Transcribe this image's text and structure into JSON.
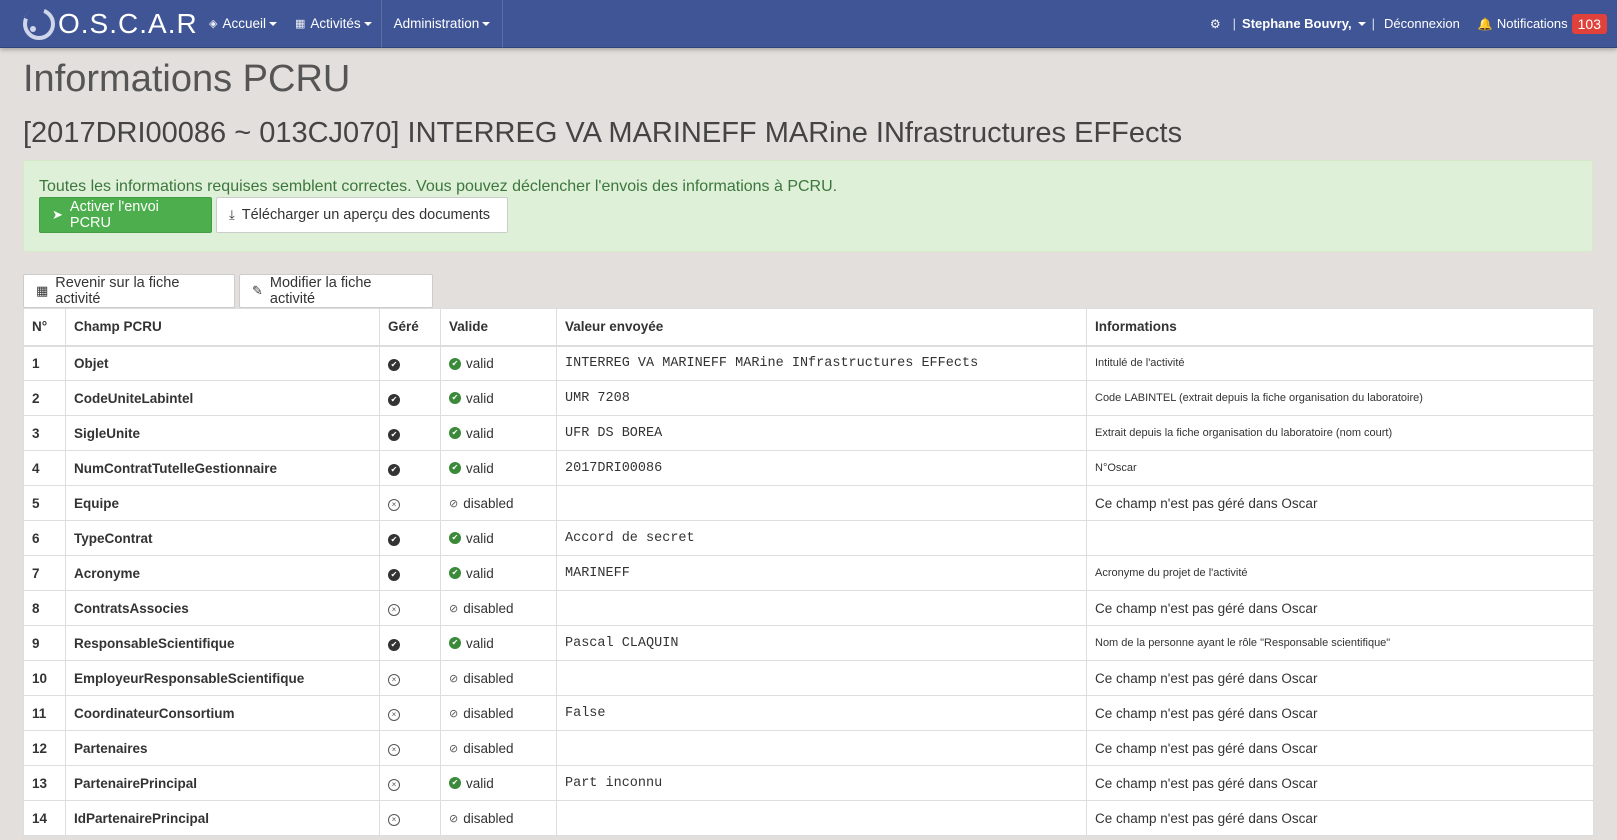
{
  "nav": {
    "brand": "O.S.C.A.R",
    "accueil": "Accueil",
    "activites": "Activités",
    "administration": "Administration",
    "separator": "|",
    "user": "Stephane Bouvry,",
    "logout": "Déconnexion",
    "notifications": "Notifications",
    "notifications_count": "103"
  },
  "page": {
    "title": "Informations PCRU",
    "activity_title": "[2017DRI00086 ~ 013CJ070] INTERREG VA MARINEFF MARine INfrastructures EFFects"
  },
  "alert": {
    "text": "Toutes les informations requises semblent correctes. Vous pouvez déclencher l'envois des informations à PCRU.",
    "activate_button": "Activer l'envoi PCRU",
    "download_button": "Télécharger un aperçu des documents"
  },
  "actions": {
    "back_button": "Revenir sur la fiche activité",
    "edit_button": "Modifier la fiche activité"
  },
  "table": {
    "headers": [
      "N°",
      "Champ PCRU",
      "Géré",
      "Valide",
      "Valeur envoyée",
      "Informations"
    ],
    "rows": [
      {
        "num": "1",
        "field": "Objet",
        "gere": true,
        "status": "valid",
        "value": "INTERREG VA MARINEFF MARine INfrastructures EFFects",
        "info": "Intitulé de l'activité",
        "info_small": true
      },
      {
        "num": "2",
        "field": "CodeUniteLabintel",
        "gere": true,
        "status": "valid",
        "value": "UMR 7208",
        "info": "Code LABINTEL (extrait depuis la fiche organisation du laboratoire)",
        "info_small": true
      },
      {
        "num": "3",
        "field": "SigleUnite",
        "gere": true,
        "status": "valid",
        "value": "UFR DS BOREA",
        "info": "Extrait depuis la fiche organisation du laboratoire (nom court)",
        "info_small": true
      },
      {
        "num": "4",
        "field": "NumContratTutelleGestionnaire",
        "gere": true,
        "status": "valid",
        "value": "2017DRI00086",
        "info": "N°Oscar",
        "info_small": true
      },
      {
        "num": "5",
        "field": "Equipe",
        "gere": false,
        "status": "disabled",
        "value": "",
        "info": "Ce champ n'est pas géré dans Oscar",
        "info_small": false
      },
      {
        "num": "6",
        "field": "TypeContrat",
        "gere": true,
        "status": "valid",
        "value": "Accord de secret",
        "info": "",
        "info_small": false
      },
      {
        "num": "7",
        "field": "Acronyme",
        "gere": true,
        "status": "valid",
        "value": "MARINEFF",
        "info": "Acronyme du projet de l'activité",
        "info_small": true
      },
      {
        "num": "8",
        "field": "ContratsAssocies",
        "gere": false,
        "status": "disabled",
        "value": "",
        "info": "Ce champ n'est pas géré dans Oscar",
        "info_small": false
      },
      {
        "num": "9",
        "field": "ResponsableScientifique",
        "gere": true,
        "status": "valid",
        "value": "Pascal CLAQUIN",
        "info": "Nom de la personne ayant le rôle \"Responsable scientifique\"",
        "info_small": true
      },
      {
        "num": "10",
        "field": "EmployeurResponsableScientifique",
        "gere": false,
        "status": "disabled",
        "value": "",
        "info": "Ce champ n'est pas géré dans Oscar",
        "info_small": false
      },
      {
        "num": "11",
        "field": "CoordinateurConsortium",
        "gere": false,
        "status": "disabled",
        "value": "False",
        "info": "Ce champ n'est pas géré dans Oscar",
        "info_small": false
      },
      {
        "num": "12",
        "field": "Partenaires",
        "gere": false,
        "status": "disabled",
        "value": "",
        "info": "Ce champ n'est pas géré dans Oscar",
        "info_small": false
      },
      {
        "num": "13",
        "field": "PartenairePrincipal",
        "gere": false,
        "status": "valid",
        "value": "Part inconnu",
        "info": "Ce champ n'est pas géré dans Oscar",
        "info_small": false
      },
      {
        "num": "14",
        "field": "IdPartenairePrincipal",
        "gere": false,
        "status": "disabled",
        "value": "",
        "info": "Ce champ n'est pas géré dans Oscar",
        "info_small": false
      }
    ]
  },
  "icons": {
    "gear": "gear-icon",
    "bell": "bell-icon",
    "send": "send-icon",
    "download": "download-icon",
    "cube": "cube-icon",
    "pencil": "pencil-icon"
  },
  "colors": {
    "navbar": "#3f5596",
    "success": "#4cae4c",
    "alert_bg": "#dff0d8",
    "alert_text": "#3c763d",
    "badge": "#e0413a",
    "valid": "#3a8a3a"
  }
}
